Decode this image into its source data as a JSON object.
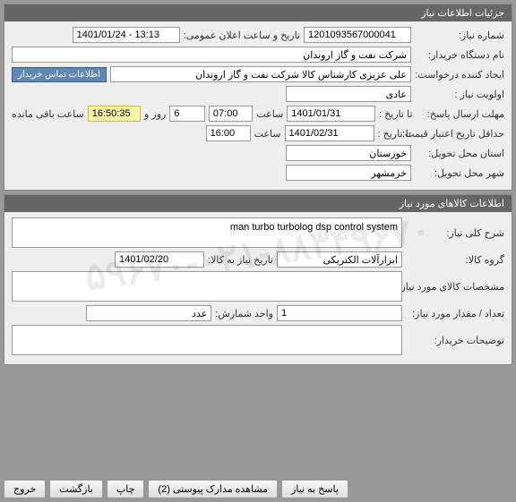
{
  "watermark": "۵۹۶۷۰-۰۲۱-۸۸۳۴۹۶۷۰",
  "panel1": {
    "title": "جزئیات اطلاعات نیاز",
    "need_no_label": "شماره نیاز:",
    "need_no": "1201093567000041",
    "public_date_label": "تاریخ و ساعت اعلان عمومی:",
    "public_date": "1401/01/24 - 13:13",
    "buyer_label": "نام دستگاه خریدار:",
    "buyer": "شرکت نفت و گاز اروندان",
    "creator_label": "ایجاد کننده درخواست:",
    "creator": "علی عزیزی کارشناس کالا شرکت نفت و گاز اروندان",
    "contact_btn": "اطلاعات تماس خریدار",
    "priority_label": "اولویت نیاز :",
    "priority": "عادی",
    "reply_deadline_label": "مهلت ارسال پاسخ:",
    "to_date_label": "تا تاریخ :",
    "reply_date": "1401/01/31",
    "time_label": "ساعت",
    "reply_time": "07:00",
    "days": "6",
    "days_label": "روز و",
    "countdown": "16:50:35",
    "remaining_label": "ساعت باقی مانده",
    "validity_label": "حداقل تاریخ اعتبار قیمت:",
    "validity_date": "1401/02/31",
    "validity_time": "16:00",
    "province_label": "استان محل تحویل:",
    "province": "خوزستان",
    "city_label": "شهر محل تحویل:",
    "city": "خرمشهر"
  },
  "panel2": {
    "title": "اطلاعات کالاهای مورد نیاز",
    "desc_label": "شرح کلی نیاز:",
    "desc": "man turbo turbolog dsp control system",
    "group_label": "گروه کالا:",
    "group": "ابزارآلات الکتریکی",
    "need_date_label": "تاریخ نیاز به کالا:",
    "need_date": "1401/02/20",
    "spec_label": "مشخصات کالای مورد نیاز:",
    "spec": "",
    "qty_label": "تعداد / مقدار مورد نیاز:",
    "qty": "1",
    "unit_label": "واحد شمارش:",
    "unit": "عدد",
    "buyer_notes_label": "توضیحات خریدار:",
    "buyer_notes": ""
  },
  "footer": {
    "exit": "خروج",
    "back": "بازگشت",
    "print": "چاپ",
    "attachments": "مشاهده مدارک پیوستی (2)",
    "reply": "پاسخ به نیاز"
  }
}
